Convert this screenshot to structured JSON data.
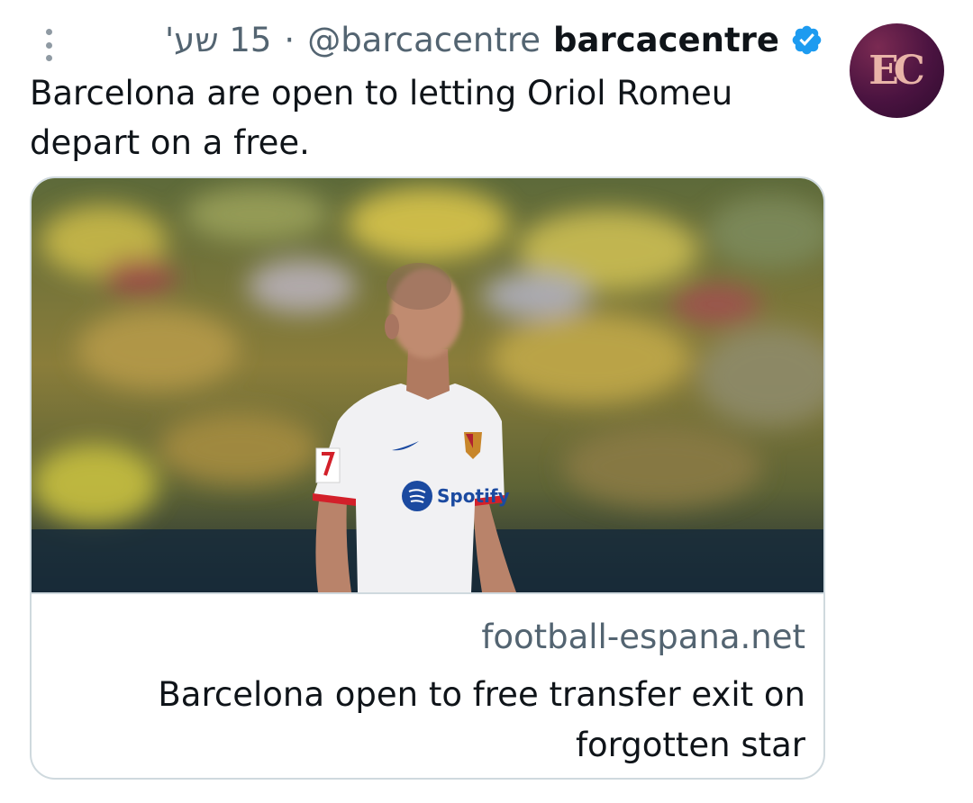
{
  "tweet": {
    "display_name": "barcacentre",
    "handle": "@barcacentre",
    "separator": "·",
    "time": "15 שע'",
    "verified": true,
    "text": "Barcelona are open to letting Oriol Romeu depart on a free."
  },
  "avatar": {
    "text": "EC",
    "colors": [
      "#7a2a52",
      "#2e0b2e",
      "#e9b4a8"
    ]
  },
  "card": {
    "domain": "football-espana.net",
    "title": "Barcelona open to free transfer exit on forgotten star",
    "image": {
      "jersey_sponsor": "Spotify"
    }
  },
  "colors": {
    "text_primary": "#0f1419",
    "text_secondary": "#536471",
    "verified_blue": "#1d9bf0",
    "border": "#cfd9de"
  }
}
